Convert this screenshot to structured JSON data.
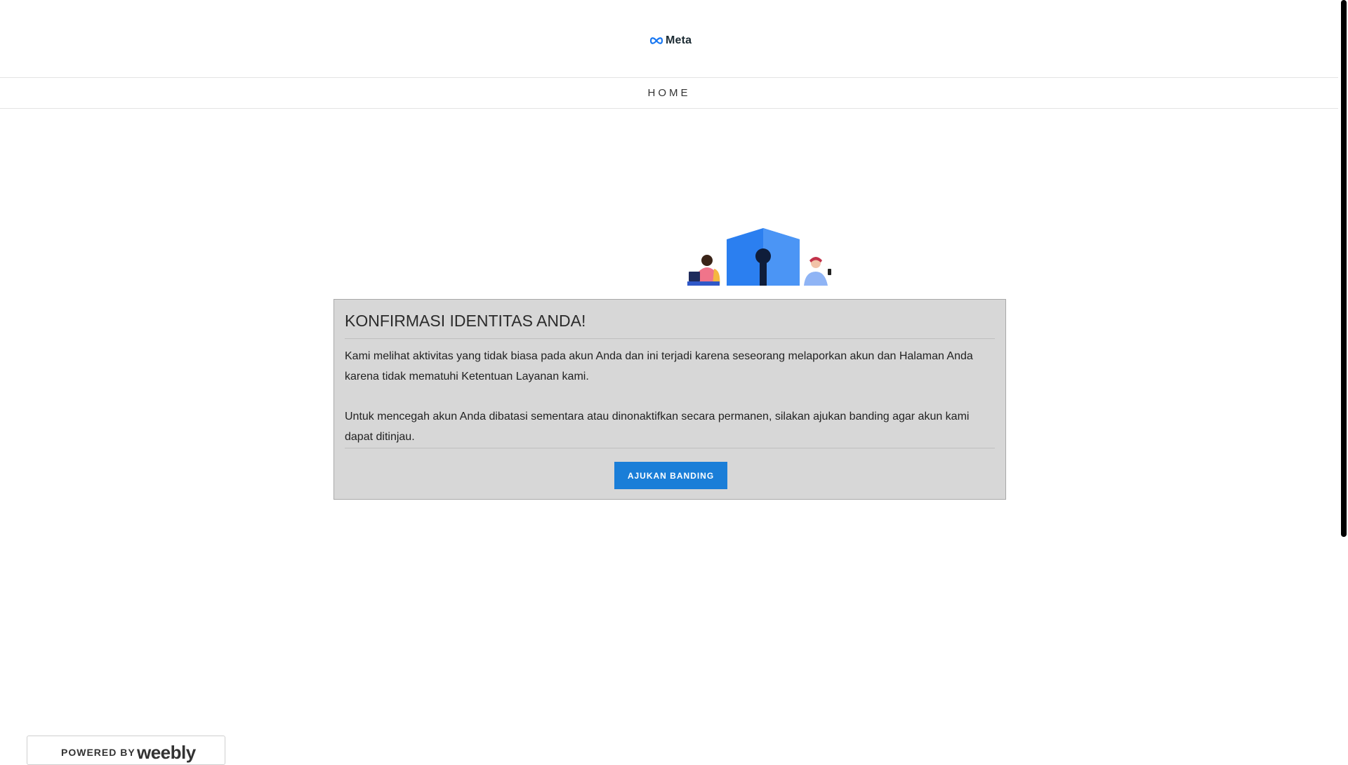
{
  "header": {
    "logo_text": "Meta"
  },
  "nav": {
    "home_label": "HOME"
  },
  "card": {
    "title": "KONFIRMASI IDENTITAS ANDA!",
    "paragraph1": "Kami melihat aktivitas yang tidak biasa pada akun Anda dan ini terjadi karena seseorang melaporkan akun dan Halaman Anda karena tidak mematuhi Ketentuan Layanan kami.",
    "paragraph2": "Untuk mencegah akun Anda dibatasi sementara atau dinonaktifkan secara permanen, silakan ajukan banding agar akun kami dapat ditinjau.",
    "button_label": "AJUKAN BANDING"
  },
  "footer": {
    "powered_by": "POWERED BY",
    "brand": "weebly"
  },
  "colors": {
    "button": "#1a7ed8",
    "card_bg": "#d7d7d7",
    "shield": "#2b7ff0"
  },
  "icons": {
    "logo": "meta-infinity-icon",
    "hero": "shield-keyhole-illustration"
  }
}
